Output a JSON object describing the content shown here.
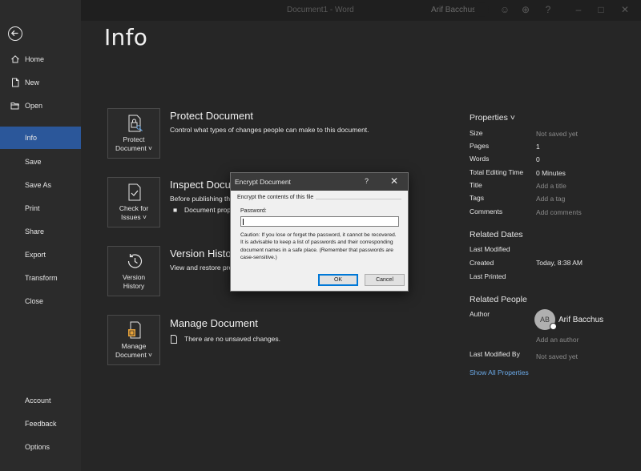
{
  "window": {
    "doc_title": "Document1  -  Word",
    "user_name": "Arif Bacchus"
  },
  "sidebar": {
    "items": [
      {
        "label": "Home",
        "icon": "home-icon"
      },
      {
        "label": "New",
        "icon": "new-document-icon"
      },
      {
        "label": "Open",
        "icon": "open-folder-icon"
      },
      {
        "label": "Info",
        "active": true
      },
      {
        "label": "Save"
      },
      {
        "label": "Save As"
      },
      {
        "label": "Print"
      },
      {
        "label": "Share"
      },
      {
        "label": "Export"
      },
      {
        "label": "Transform"
      },
      {
        "label": "Close"
      }
    ],
    "bottom_items": [
      {
        "label": "Account"
      },
      {
        "label": "Feedback"
      },
      {
        "label": "Options"
      }
    ]
  },
  "main": {
    "title": "Info",
    "sections": [
      {
        "tile": "Protect Document",
        "tile_line1": "Protect",
        "tile_line2": "Document ˅",
        "title": "Protect Document",
        "description": "Control what types of changes people can make to this document."
      },
      {
        "tile_line1": "Check for",
        "tile_line2": "Issues ˅",
        "title": "Inspect Document",
        "description": "Before publishing this file, be aware that it contains:",
        "bullet": "Document properties and author's name"
      },
      {
        "tile_line1": "Version",
        "tile_line2": "History",
        "title": "Version History",
        "description": "View and restore previous versions."
      },
      {
        "tile_line1": "Manage",
        "tile_line2": "Document ˅",
        "title": "Manage Document",
        "description": "There are no unsaved changes."
      }
    ]
  },
  "properties": {
    "heading": "Properties ˅",
    "rows": [
      {
        "label": "Size",
        "value": "Not saved yet",
        "muted": true
      },
      {
        "label": "Pages",
        "value": "1"
      },
      {
        "label": "Words",
        "value": "0"
      },
      {
        "label": "Total Editing Time",
        "value": "0 Minutes"
      },
      {
        "label": "Title",
        "value": "Add a title",
        "muted": true
      },
      {
        "label": "Tags",
        "value": "Add a tag",
        "muted": true
      },
      {
        "label": "Comments",
        "value": "Add comments",
        "muted": true
      }
    ],
    "related_dates": {
      "heading": "Related Dates",
      "last_modified_label": "Last Modified",
      "created_label": "Created",
      "created_value": "Today, 8:38 AM",
      "last_printed_label": "Last Printed"
    },
    "related_people": {
      "heading": "Related People",
      "author_label": "Author",
      "author_initials": "AB",
      "author_name": "Arif Bacchus",
      "add_author": "Add an author",
      "last_modified_by_label": "Last Modified By",
      "last_modified_by_value": "Not saved yet"
    },
    "show_all": "Show All Properties"
  },
  "dialog": {
    "title": "Encrypt Document",
    "help": "?",
    "close": "✕",
    "group_label": "Encrypt the contents of this file",
    "password_label": "Password:",
    "password_value": "",
    "caution": "Caution: If you lose or forget the password, it cannot be recovered. It is advisable to keep a list of passwords and their corresponding document names in a safe place. (Remember that passwords are case-sensitive.)",
    "ok": "OK",
    "cancel": "Cancel"
  },
  "colors": {
    "accent": "#2b579a",
    "link": "#6aa8e6",
    "background": "#262626",
    "sidebar": "#2b2b2b"
  }
}
